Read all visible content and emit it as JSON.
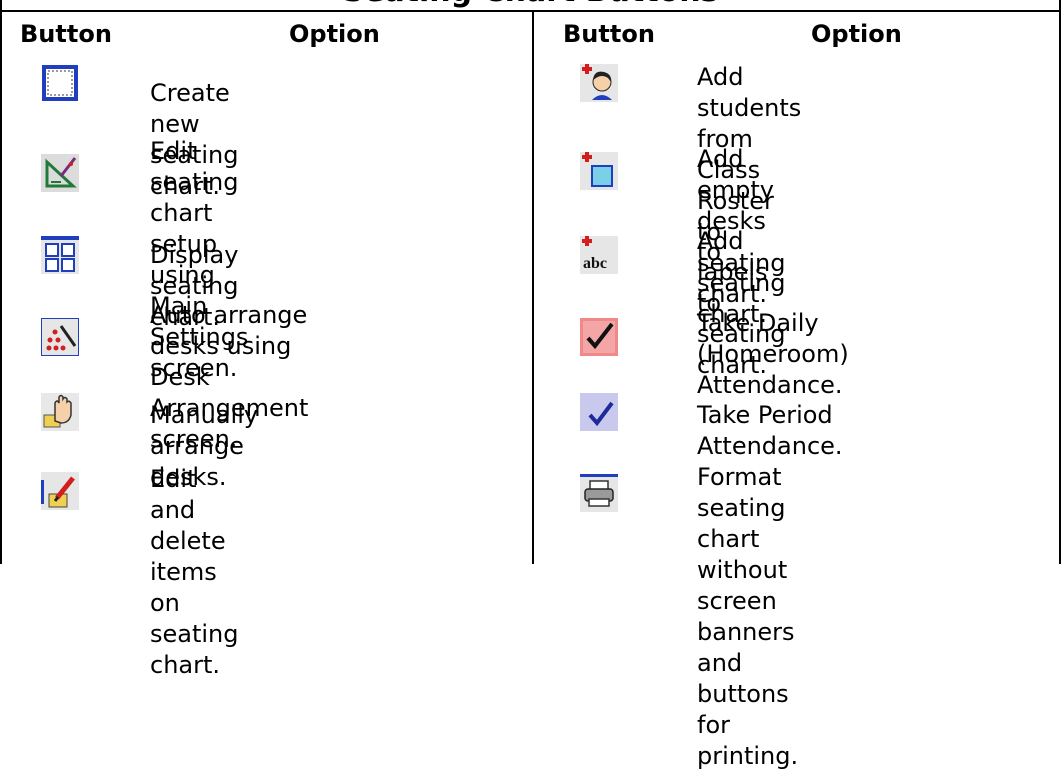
{
  "title": "Seating Chart Buttons",
  "headers": {
    "left_button": "Button",
    "left_option": "Option",
    "right_button": "Button",
    "right_option": "Option"
  },
  "left_rows": [
    {
      "icon": "new-chart-icon",
      "text": "Create new seating chart."
    },
    {
      "icon": "setup-edit-icon",
      "text": "Edit seating chart setup\nusing Main Settings screen."
    },
    {
      "icon": "display-grid-icon",
      "text": "Display seating chart."
    },
    {
      "icon": "auto-arrange-icon",
      "text": "Auto arrange desks using\nDesk Arrangement screen."
    },
    {
      "icon": "manual-arrange-hand-icon",
      "text": "Manually arrange desks."
    },
    {
      "icon": "edit-delete-pencil-icon",
      "text": "Edit and delete items on\nseating chart."
    }
  ],
  "right_rows": [
    {
      "icon": "add-student-icon",
      "text": "Add students from Class\nRoster to seating chart."
    },
    {
      "icon": "add-desk-icon",
      "text": "Add empty desks to\nseating chart."
    },
    {
      "icon": "add-label-abc-icon",
      "text": "Add labels to seating\nchart."
    },
    {
      "icon": "daily-attendance-check-icon",
      "text": "Take Daily (Homeroom)\nAttendance."
    },
    {
      "icon": "period-attendance-check-icon",
      "text": "Take Period Attendance."
    },
    {
      "icon": "printer-icon",
      "text": "Format seating chart\nwithout screen banners\nand buttons for printing."
    }
  ],
  "colors": {
    "border": "#000000",
    "icon_blue": "#1f3fbf",
    "icon_red": "#d21e1e",
    "icon_face": "#f5d0a8",
    "icon_pink": "#f08a8a",
    "icon_lilac": "#c9c9ee"
  }
}
